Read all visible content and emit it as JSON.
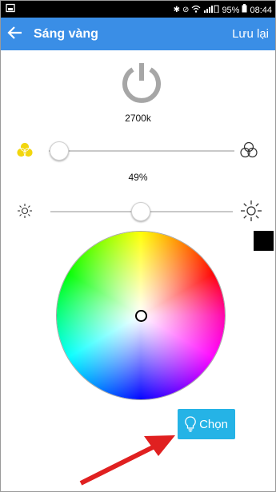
{
  "status_bar": {
    "battery_percent": "95%",
    "time": "08:44",
    "icons": [
      "bluetooth-icon",
      "mute-icon",
      "wifi-icon",
      "signal-icon",
      "battery-icon"
    ]
  },
  "app_bar": {
    "title": "Sáng vàng",
    "save_label": "Lưu lại",
    "back_icon": "arrow-left-icon"
  },
  "power": {
    "icon": "power-icon",
    "color": "#a6a6a6"
  },
  "temperature": {
    "label": "2700k",
    "slider_value": 0.05
  },
  "brightness": {
    "label": "49%",
    "slider_value": 0.49
  },
  "current_color": "#000000",
  "color_wheel": {
    "picker": "center"
  },
  "choose_button": {
    "label": "Chọn",
    "icon": "lightbulb-icon",
    "color": "#25b3e6"
  },
  "annotation": {
    "icon": "red-arrow",
    "color": "#e02020"
  },
  "colors": {
    "app_bar": "#3a8ee6",
    "warm_icon": "#f2d60d"
  }
}
